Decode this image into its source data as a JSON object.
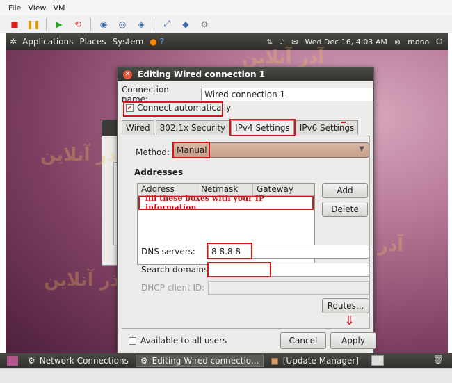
{
  "vm_menu": [
    "File",
    "View",
    "VM"
  ],
  "top_panel": {
    "menus": [
      "Applications",
      "Places",
      "System"
    ],
    "datetime": "Wed Dec 16,  4:03 AM",
    "user": "mono"
  },
  "dialog": {
    "title": "Editing Wired connection 1",
    "connection_name_label": "Connection name:",
    "connection_name_value": "Wired connection 1",
    "connect_automatically": "Connect automatically",
    "tabs": [
      "Wired",
      "802.1x Security",
      "IPv4 Settings",
      "IPv6 Settings"
    ],
    "method_label": "Method:",
    "method_value": "Manual",
    "addresses_label": "Addresses",
    "columns": [
      "Address",
      "Netmask",
      "Gateway"
    ],
    "add_label": "Add",
    "delete_label": "Delete",
    "note": "fill these boxes with your IP information",
    "dns_label": "DNS servers:",
    "dns_value": "8.8.8.8",
    "search_label": "Search domains:",
    "search_value": "",
    "dhcp_label": "DHCP client ID:",
    "routes_label": "Routes...",
    "available_label": "Available to all users",
    "cancel_label": "Cancel",
    "apply_label": "Apply"
  },
  "taskbar": {
    "items": [
      "Network Connections",
      "Editing Wired connectio...",
      "[Update Manager]"
    ]
  },
  "colors": {
    "highlight": "#d4161d",
    "panel": "#3c3b37"
  }
}
